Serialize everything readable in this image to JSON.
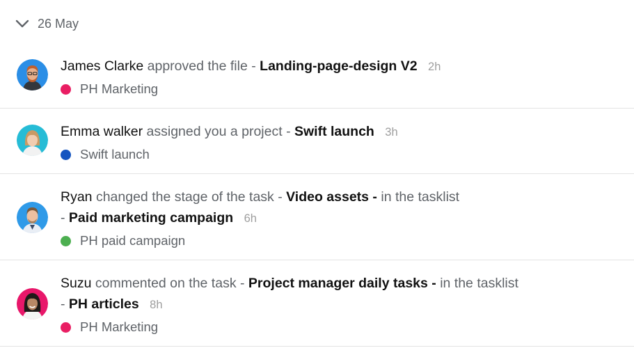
{
  "date_label": "26 May",
  "colors": {
    "pink": "#e91e63",
    "blue": "#1565c0",
    "green": "#4caf50"
  },
  "items": [
    {
      "actor": "James Clarke",
      "action": "approved the file -",
      "target": "Landing-page-design V2",
      "time": "2h",
      "project": "PH Marketing",
      "project_color": "#e91e63"
    },
    {
      "actor": "Emma walker",
      "action": "assigned you a project -",
      "target": "Swift launch",
      "time": "3h",
      "project": "Swift launch",
      "project_color": "#1555c0"
    },
    {
      "actor": "Ryan",
      "action": "changed the stage of the task -",
      "target": "Video assets -",
      "suffix": "in the tasklist",
      "list_prefix": "-",
      "list_name": "Paid marketing campaign",
      "time": "6h",
      "project": "PH paid campaign",
      "project_color": "#4caf50"
    },
    {
      "actor": "Suzu",
      "action": "commented on the task -",
      "target": "Project manager daily tasks -",
      "suffix": "in the tasklist",
      "list_prefix": "-",
      "list_name": "PH articles",
      "time": "8h",
      "project": "PH Marketing",
      "project_color": "#e91e63"
    }
  ]
}
